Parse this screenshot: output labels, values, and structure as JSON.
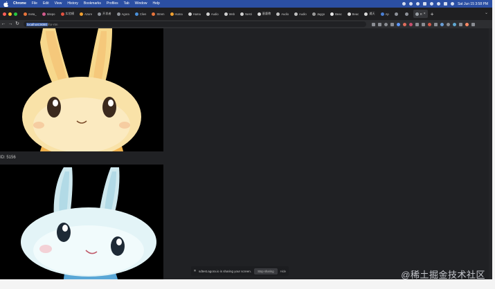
{
  "colors": {
    "menubar": "#2b4fa3",
    "tabstrip": "#1f1f21",
    "toolbar": "#2d2e31",
    "page_bg": "#202124"
  },
  "menubar": {
    "app": "Chrome",
    "items": [
      "File",
      "Edit",
      "View",
      "History",
      "Bookmarks",
      "Profiles",
      "Tab",
      "Window",
      "Help"
    ],
    "clock": "Sat Jun 15  3:58 PM"
  },
  "tabs": [
    {
      "label": "meta_",
      "icon": "orange-circle-icon",
      "color": "#e8743b"
    },
    {
      "label": "Sitepo",
      "icon": "pink-circle-icon",
      "color": "#d15a8c"
    },
    {
      "label": "实验模",
      "icon": "red-circle-icon",
      "color": "#e15240"
    },
    {
      "label": "Azure",
      "icon": "orange-circle-icon",
      "color": "#f0a030"
    },
    {
      "label": "开发者",
      "icon": "folder-icon",
      "color": "#8e9299"
    },
    {
      "label": "Agora",
      "icon": "gray-circle-icon",
      "color": "#8e9299"
    },
    {
      "label": "Clien",
      "icon": "blue-circle-icon",
      "color": "#4a90d9"
    },
    {
      "label": "Strem",
      "icon": "orange-circle-icon",
      "color": "#e8743b"
    },
    {
      "label": "Huma",
      "icon": "orange-circle-icon",
      "color": "#f0a030"
    },
    {
      "label": "Huma",
      "icon": "diamond-icon",
      "color": "#cfcfcf"
    },
    {
      "label": "Audio",
      "icon": "diamond-icon",
      "color": "#cfcfcf"
    },
    {
      "label": "Web",
      "icon": "diamond-icon",
      "color": "#cfcfcf"
    },
    {
      "label": "Nesti",
      "icon": "diamond-icon",
      "color": "#cfcfcf"
    },
    {
      "label": "基督教",
      "icon": "square-icon",
      "color": "#d9d9d9"
    },
    {
      "label": "Audio",
      "icon": "gray-circle-icon",
      "color": "#bfbfbf"
    },
    {
      "label": "Audio",
      "icon": "gray-circle-icon",
      "color": "#bfbfbf"
    },
    {
      "label": "Jaggo",
      "icon": "loading-icon",
      "color": "#9a9a9a"
    },
    {
      "label": "Beac",
      "icon": "github-icon",
      "color": "#e6e6e6"
    },
    {
      "label": "Beac",
      "icon": "doc-icon",
      "color": "#d9d9d9"
    },
    {
      "label": "通天",
      "icon": "doc-icon",
      "color": "#d9d9d9"
    },
    {
      "label": "Ap",
      "icon": "blue-square-icon",
      "color": "#4a7fd4"
    },
    {
      "label": "",
      "icon": "gray-circle-icon",
      "color": "#8e9299"
    },
    {
      "label": "",
      "icon": "gray-circle-icon",
      "color": "#8e9299"
    },
    {
      "label": "R",
      "icon": "active-tab-icon",
      "color": "#9aa0a6",
      "active": true
    }
  ],
  "toolbar": {
    "back": "←",
    "forward": "→",
    "reload": "↻",
    "url_selected": "localhost:8080",
    "url_rest": "/for-rtm"
  },
  "page": {
    "caption": "ID: 5156"
  },
  "share_bar": {
    "text": "sdtest.agora.io is sharing your screen.",
    "stop_label": "Stop sharing",
    "hide_label": "Hide"
  },
  "watermark": "@稀土掘金技术社区"
}
